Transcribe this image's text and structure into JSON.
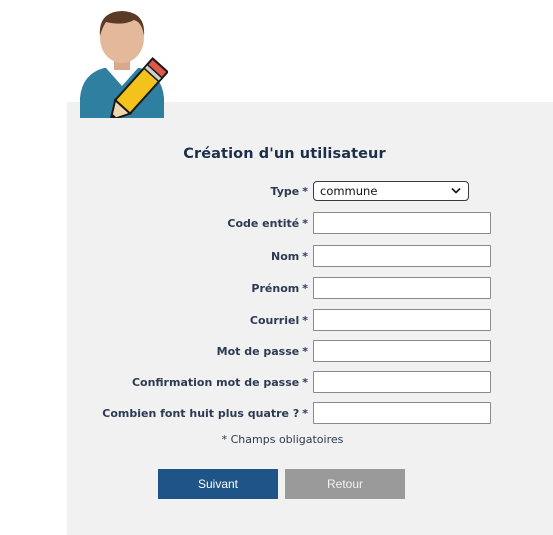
{
  "form": {
    "title": "Création d'un utilisateur",
    "fields": [
      {
        "label": "Type",
        "required_mark": "*",
        "kind": "select",
        "value": "commune"
      },
      {
        "label": "Code entité",
        "required_mark": "*",
        "kind": "text",
        "value": ""
      },
      {
        "label": "Nom",
        "required_mark": "*",
        "kind": "text",
        "value": ""
      },
      {
        "label": "Prénom",
        "required_mark": "*",
        "kind": "text",
        "value": ""
      },
      {
        "label": "Courriel",
        "required_mark": "*",
        "kind": "text",
        "value": ""
      },
      {
        "label": "Mot de passe",
        "required_mark": "*",
        "kind": "password",
        "value": ""
      },
      {
        "label": "Confirmation mot de passe",
        "required_mark": "*",
        "kind": "password",
        "value": ""
      },
      {
        "label": "Combien font huit plus quatre ?",
        "required_mark": "*",
        "kind": "text",
        "value": ""
      }
    ],
    "required_note": "* Champs obligatoires",
    "next_label": "Suivant",
    "back_label": "Retour"
  },
  "icons": {
    "header": "user-edit-icon",
    "dropdown": "chevron-down-icon"
  },
  "colors": {
    "panel_bg": "#f1f1f1",
    "title_text": "#1c2f49",
    "next_button": "#1f5488",
    "back_button": "#9a9a9a"
  }
}
